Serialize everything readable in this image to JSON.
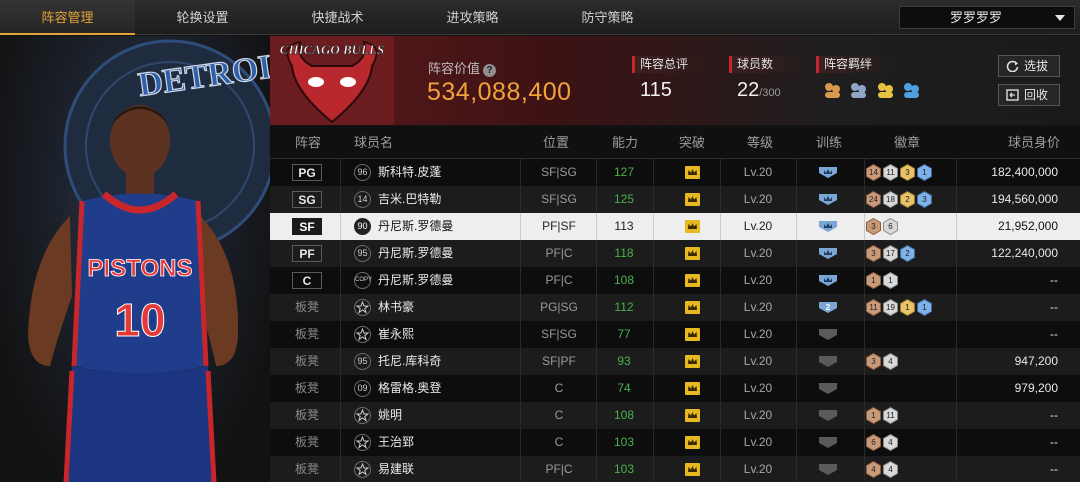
{
  "tabs": [
    {
      "label": "阵容管理",
      "active": true
    },
    {
      "label": "轮换设置",
      "active": false
    },
    {
      "label": "快捷战术",
      "active": false
    },
    {
      "label": "进攻策略",
      "active": false
    },
    {
      "label": "防守策略",
      "active": false
    }
  ],
  "team_select": {
    "value": "罗罗罗罗"
  },
  "art": {
    "team_text": "DETROIT PISTONS",
    "jersey_text": "PISTONS",
    "jersey_number": "10",
    "logo_text": "CHICAGO BULLS"
  },
  "header": {
    "value_label": "阵容价值",
    "value": "534,088,400",
    "rating_label": "阵容总评",
    "rating": "115",
    "count_label": "球员数",
    "count": "22",
    "count_max": "/300",
    "bond_label": "阵容羁绊",
    "bond_icon_colors": [
      "#d69a4a",
      "#8fa6c8",
      "#e8c340",
      "#4e9ee0"
    ],
    "select_button": "选拔",
    "recycle_button": "回收"
  },
  "columns": [
    "阵容",
    "球员名",
    "位置",
    "能力",
    "突破",
    "等级",
    "训练",
    "徽章",
    "球员身价"
  ],
  "rows": [
    {
      "slot": "PG",
      "num": "96",
      "name": "斯科特.皮蓬",
      "pos": "SF|SG",
      "ability": "127",
      "level": "Lv.20",
      "train": "blue",
      "badges": [
        [
          "14",
          "bronze"
        ],
        [
          "11",
          "silver"
        ],
        [
          "3",
          "gold"
        ],
        [
          "1",
          "blue"
        ]
      ],
      "price": "182,400,000"
    },
    {
      "slot": "SG",
      "num": "14",
      "name": "吉米.巴特勒",
      "pos": "SF|SG",
      "ability": "125",
      "level": "Lv.20",
      "train": "blue",
      "badges": [
        [
          "24",
          "bronze"
        ],
        [
          "18",
          "silver"
        ],
        [
          "2",
          "gold"
        ],
        [
          "3",
          "blue"
        ]
      ],
      "price": "194,560,000"
    },
    {
      "slot": "SF",
      "num": "90",
      "name": "丹尼斯.罗德曼",
      "pos": "PF|SF",
      "ability": "113",
      "level": "Lv.20",
      "train": "blue",
      "badges": [
        [
          "3",
          "bronze"
        ],
        [
          "6",
          "silver"
        ]
      ],
      "price": "21,952,000",
      "selected": true
    },
    {
      "slot": "PF",
      "num": "95",
      "name": "丹尼斯.罗德曼",
      "pos": "PF|C",
      "ability": "118",
      "level": "Lv.20",
      "train": "blue",
      "badges": [
        [
          "3",
          "bronze"
        ],
        [
          "17",
          "silver"
        ],
        [
          "2",
          "blue"
        ]
      ],
      "price": "122,240,000"
    },
    {
      "slot": "C",
      "num": "COPY",
      "name": "丹尼斯.罗德曼",
      "pos": "PF|C",
      "ability": "108",
      "level": "Lv.20",
      "train": "blue",
      "badges": [
        [
          "1",
          "bronze"
        ],
        [
          "1",
          "silver"
        ]
      ],
      "price": "--"
    },
    {
      "slot": "板凳",
      "num": "star",
      "name": "林书豪",
      "pos": "PG|SG",
      "ability": "112",
      "level": "Lv.20",
      "train": "blue2",
      "badges": [
        [
          "11",
          "bronze"
        ],
        [
          "19",
          "silver"
        ],
        [
          "1",
          "gold"
        ],
        [
          "1",
          "blue"
        ]
      ],
      "price": "--"
    },
    {
      "slot": "板凳",
      "num": "star",
      "name": "崔永熙",
      "pos": "SF|SG",
      "ability": "77",
      "level": "Lv.20",
      "train": "gray",
      "badges": [],
      "price": "--"
    },
    {
      "slot": "板凳",
      "num": "95",
      "name": "托尼.库科奇",
      "pos": "SF|PF",
      "ability": "93",
      "level": "Lv.20",
      "train": "gray",
      "badges": [
        [
          "3",
          "bronze"
        ],
        [
          "4",
          "silver"
        ]
      ],
      "price": "947,200"
    },
    {
      "slot": "板凳",
      "num": "09",
      "name": "格雷格.奥登",
      "pos": "C",
      "ability": "74",
      "level": "Lv.20",
      "train": "gray",
      "badges": [],
      "price": "979,200"
    },
    {
      "slot": "板凳",
      "num": "star",
      "name": "姚明",
      "pos": "C",
      "ability": "108",
      "level": "Lv.20",
      "train": "gray",
      "badges": [
        [
          "1",
          "bronze"
        ],
        [
          "11",
          "silver"
        ]
      ],
      "price": "--"
    },
    {
      "slot": "板凳",
      "num": "star",
      "name": "王治郅",
      "pos": "C",
      "ability": "103",
      "level": "Lv.20",
      "train": "gray",
      "badges": [
        [
          "6",
          "bronze"
        ],
        [
          "4",
          "silver"
        ]
      ],
      "price": "--"
    },
    {
      "slot": "板凳",
      "num": "star",
      "name": "易建联",
      "pos": "PF|C",
      "ability": "103",
      "level": "Lv.20",
      "train": "gray",
      "badges": [
        [
          "4",
          "bronze"
        ],
        [
          "4",
          "silver"
        ]
      ],
      "price": "--"
    }
  ]
}
